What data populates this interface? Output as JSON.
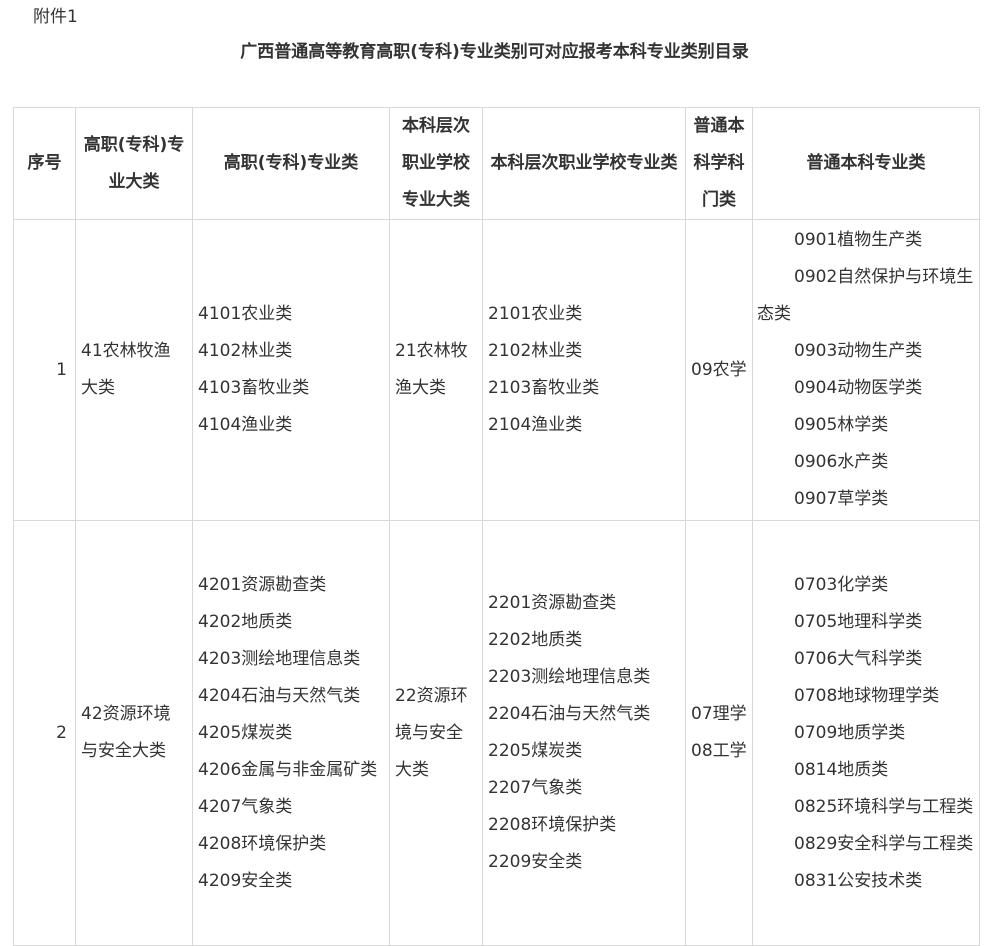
{
  "header": {
    "attachment_label": "附件1",
    "title": "广西普通高等教育高职(专科)专业类别可对应报考本科专业类别目录"
  },
  "table": {
    "columns": [
      "序号",
      "高职(专科)专业大类",
      "高职(专科)专业类",
      "本科层次职业学校专业大类",
      "本科层次职业学校专业类",
      "普通本科学科门类",
      "普通本科专业类"
    ],
    "rows": [
      {
        "seq": "1",
        "gz_major": "41农林牧渔大类",
        "gz_classes": [
          "4101农业类",
          "4102林业类",
          "4103畜牧业类",
          "4104渔业类"
        ],
        "bk_voc_major": "21农林牧渔大类",
        "bk_voc_classes": [
          "2101农业类",
          "2102林业类",
          "2103畜牧业类",
          "2104渔业类"
        ],
        "disciplines": [
          "09农学"
        ],
        "bk_classes": [
          "0901植物生产类",
          "0902自然保护与环境生态类",
          "0903动物生产类",
          "0904动物医学类",
          "0905林学类",
          "0906水产类",
          "0907草学类"
        ]
      },
      {
        "seq": "2",
        "gz_major": "42资源环境与安全大类",
        "gz_classes": [
          "4201资源勘查类",
          "4202地质类",
          "4203测绘地理信息类",
          "4204石油与天然气类",
          "4205煤炭类",
          "4206金属与非金属矿类",
          "4207气象类",
          "4208环境保护类",
          "4209安全类"
        ],
        "bk_voc_major": "22资源环境与安全大类",
        "bk_voc_classes": [
          "2201资源勘查类",
          "2202地质类",
          "2203测绘地理信息类",
          "2204石油与天然气类",
          "2205煤炭类",
          "2207气象类",
          "2208环境保护类",
          "2209安全类"
        ],
        "disciplines": [
          "07理学",
          "08工学"
        ],
        "bk_classes": [
          "0703化学类",
          "0705地理科学类",
          "0706大气科学类",
          "0708地球物理学类",
          "0709地质学类",
          "0814地质类",
          "0825环境科学与工程类",
          "0829安全科学与工程类",
          "0831公安技术类"
        ]
      }
    ]
  }
}
